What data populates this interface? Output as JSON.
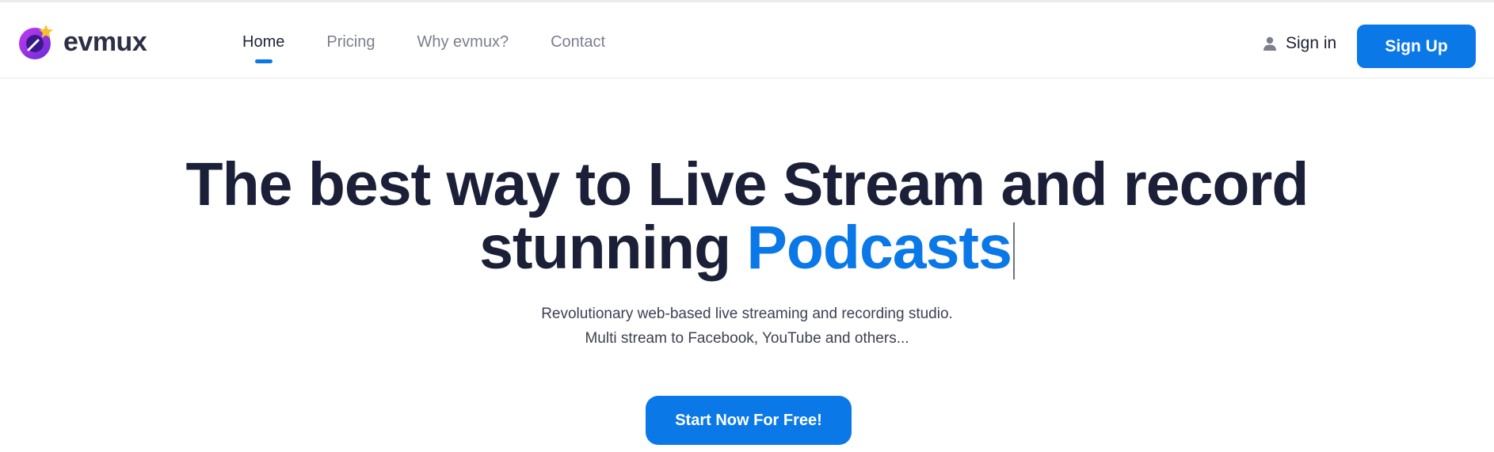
{
  "brand": {
    "name": "evmux",
    "logo_icon": "evmux-logo-icon"
  },
  "nav": {
    "items": [
      {
        "label": "Home",
        "active": true
      },
      {
        "label": "Pricing",
        "active": false
      },
      {
        "label": "Why evmux?",
        "active": false
      },
      {
        "label": "Contact",
        "active": false
      }
    ]
  },
  "auth": {
    "signin_label": "Sign in",
    "signin_icon": "person-icon",
    "signup_label": "Sign Up"
  },
  "hero": {
    "title_line1": "The best way to Live Stream and record",
    "title_line2_prefix": "stunning ",
    "title_highlight": "Podcasts",
    "subtitle_line1": "Revolutionary web-based live streaming and recording studio.",
    "subtitle_line2": "Multi stream to Facebook, YouTube and others...",
    "cta_label": "Start Now For Free!"
  },
  "colors": {
    "accent": "#0b78e8",
    "heading": "#1b2038",
    "nav_inactive": "#7b7f8d"
  }
}
